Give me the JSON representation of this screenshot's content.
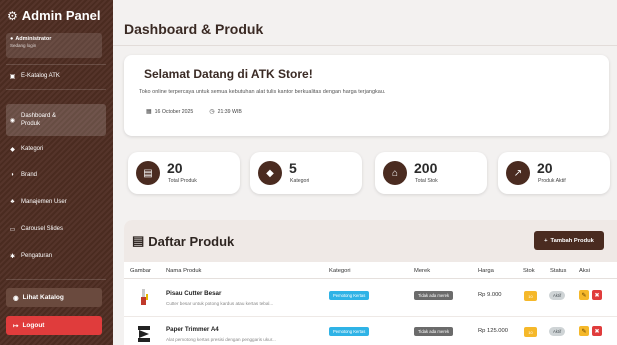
{
  "sidebar": {
    "brand_title": "Admin Panel",
    "user_name": "Administrator",
    "user_status": "Sedang login",
    "section": "E-Katalog ATK",
    "items": [
      {
        "label": "Dashboard & Produk",
        "icon": "gauge-icon"
      },
      {
        "label": "Kategori",
        "icon": "tag-icon"
      },
      {
        "label": "Brand",
        "icon": "label-icon"
      },
      {
        "label": "Manajemen User",
        "icon": "users-icon"
      },
      {
        "label": "Carousel Slides",
        "icon": "slides-icon"
      },
      {
        "label": "Pengaturan",
        "icon": "gear-icon"
      }
    ],
    "catalog_button": "Lihat Katalog",
    "logout_button": "Logout"
  },
  "header": {
    "title": "Dashboard & Produk"
  },
  "welcome": {
    "heading": "Selamat Datang di ATK Store!",
    "description": "Toko online terpercaya untuk semua kebutuhan alat tulis kantor berkualitas dengan harga terjangkau.",
    "date": "16 October 2025",
    "time": "21:39 WIB"
  },
  "stats": [
    {
      "value": "20",
      "label": "Total Produk",
      "icon": "box-icon"
    },
    {
      "value": "5",
      "label": "Kategori",
      "icon": "tags-icon"
    },
    {
      "value": "200",
      "label": "Total Stok",
      "icon": "warehouse-icon"
    },
    {
      "value": "20",
      "label": "Produk Aktif",
      "icon": "trend-icon"
    }
  ],
  "products_panel": {
    "title": "Daftar Produk",
    "add_button": "Tambah Produk",
    "columns": [
      "Gambar",
      "Nama Produk",
      "Kategori",
      "Merek",
      "Harga",
      "Stok",
      "Status",
      "Aksi"
    ],
    "rows": [
      {
        "name": "Pisau Cutter Besar",
        "desc": "Cutter besar untuk potong kardus atau kertas tebal...",
        "category": "Pemotong Kertas",
        "brand": "Tidak ada merek",
        "price": "Rp 9.000",
        "stock": "10",
        "status": "Aktif"
      },
      {
        "name": "Paper Trimmer A4",
        "desc": "Alat pemotong kertas presisi dengan penggaris ukur...",
        "category": "Pemotong Kertas",
        "brand": "Tidak ada merek",
        "price": "Rp 125.000",
        "stock": "10",
        "status": "Aktif"
      }
    ]
  },
  "colors": {
    "sidebar": "#4a2b20",
    "accent": "#4a2b20",
    "logout": "#e03c3c",
    "category_badge": "#2fb3e6",
    "stock_badge": "#f5b82a"
  }
}
